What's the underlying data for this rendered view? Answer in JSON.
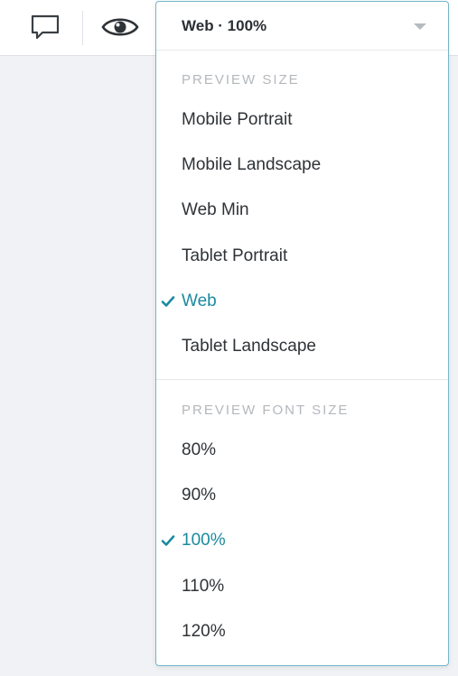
{
  "toolbar": {
    "comment_icon": "speech-bubble-icon",
    "preview_icon": "eye-icon"
  },
  "dropdown": {
    "trigger_label": "Web · 100%",
    "accent_color": "#1a8aa0",
    "preview_size": {
      "heading": "PREVIEW SIZE",
      "options": [
        {
          "label": "Mobile Portrait",
          "selected": false
        },
        {
          "label": "Mobile Landscape",
          "selected": false
        },
        {
          "label": "Web Min",
          "selected": false
        },
        {
          "label": "Tablet Portrait",
          "selected": false
        },
        {
          "label": "Web",
          "selected": true
        },
        {
          "label": "Tablet Landscape",
          "selected": false
        }
      ]
    },
    "preview_font_size": {
      "heading": "PREVIEW FONT SIZE",
      "options": [
        {
          "label": "80%",
          "selected": false
        },
        {
          "label": "90%",
          "selected": false
        },
        {
          "label": "100%",
          "selected": true
        },
        {
          "label": "110%",
          "selected": false
        },
        {
          "label": "120%",
          "selected": false
        }
      ]
    }
  }
}
